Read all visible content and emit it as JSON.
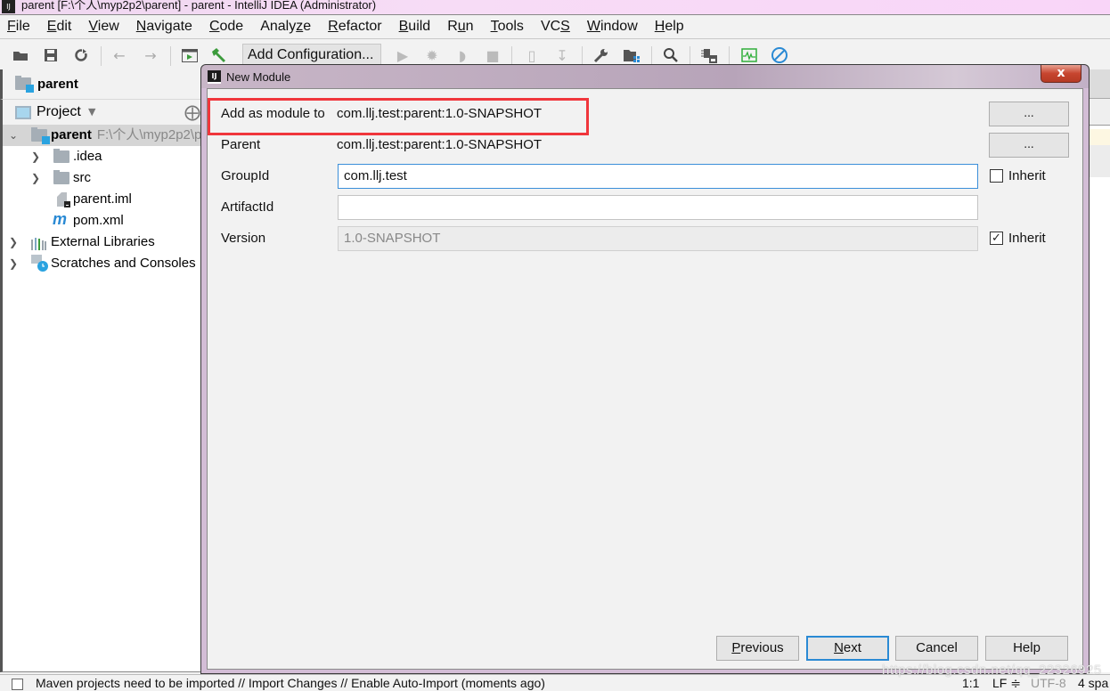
{
  "window": {
    "title": "parent [F:\\个人\\myp2p2\\parent] - parent - IntelliJ IDEA (Administrator)"
  },
  "menu": [
    {
      "label": "File",
      "mnemonic": "F",
      "rest": "ile"
    },
    {
      "label": "Edit",
      "mnemonic": "E",
      "rest": "dit"
    },
    {
      "label": "View",
      "mnemonic": "V",
      "rest": "iew"
    },
    {
      "label": "Navigate",
      "mnemonic": "N",
      "rest": "avigate"
    },
    {
      "label": "Code",
      "mnemonic": "C",
      "rest": "ode"
    },
    {
      "label": "Analyze",
      "pre": "Analy",
      "mnemonic": "z",
      "rest": "e"
    },
    {
      "label": "Refactor",
      "mnemonic": "R",
      "rest": "efactor"
    },
    {
      "label": "Build",
      "mnemonic": "B",
      "rest": "uild"
    },
    {
      "label": "Run",
      "pre": "R",
      "mnemonic": "u",
      "rest": "n"
    },
    {
      "label": "Tools",
      "mnemonic": "T",
      "rest": "ools"
    },
    {
      "label": "VCS",
      "pre": "VC",
      "mnemonic": "S",
      "rest": ""
    },
    {
      "label": "Window",
      "mnemonic": "W",
      "rest": "indow"
    },
    {
      "label": "Help",
      "mnemonic": "H",
      "rest": "elp"
    }
  ],
  "toolbar": {
    "add_configuration_label": "Add Configuration...",
    "icons": [
      "open-folder-icon",
      "save-icon",
      "sync-icon",
      "back-arrow-icon",
      "forward-arrow-icon",
      "run-window-icon",
      "build-hammer-icon",
      "run-icon",
      "debug-icon",
      "coverage-icon",
      "stop-icon",
      "vcs-update-icon",
      "vcs-commit-icon",
      "settings-wrench-icon",
      "project-structure-icon",
      "search-icon",
      "sdk-icon",
      "activity-monitor-icon",
      "power-save-icon"
    ]
  },
  "project_panel": {
    "header_name": "parent",
    "view_label": "Project",
    "tree": [
      {
        "label": "parent",
        "path": "F:\\个人\\myp2p2\\p",
        "expanded": true,
        "selected": true,
        "bold": true
      },
      {
        "label": ".idea",
        "expanded": false
      },
      {
        "label": "src",
        "expanded": false
      },
      {
        "label": "parent.iml"
      },
      {
        "label": "pom.xml"
      },
      {
        "label": "External Libraries",
        "expanded": false
      },
      {
        "label": "Scratches and Consoles",
        "expanded": false
      }
    ]
  },
  "dialog": {
    "title": "New Module",
    "close_label": "x",
    "fields": {
      "add_as_module_to": {
        "label": "Add as module to",
        "value": "com.llj.test:parent:1.0-SNAPSHOT",
        "button": "..."
      },
      "parent": {
        "label": "Parent",
        "value": "com.llj.test:parent:1.0-SNAPSHOT",
        "button": "..."
      },
      "group_id": {
        "label": "GroupId",
        "value": "com.llj.test",
        "inherit_label": "Inherit",
        "inherit_checked": false
      },
      "artifact_id": {
        "label": "ArtifactId",
        "value": ""
      },
      "version": {
        "label": "Version",
        "value": "1.0-SNAPSHOT",
        "inherit_label": "Inherit",
        "inherit_checked": true
      }
    },
    "buttons": {
      "previous": {
        "mnemonic": "P",
        "rest": "revious"
      },
      "next": {
        "mnemonic": "N",
        "rest": "ext"
      },
      "cancel": "Cancel",
      "help": "Help"
    },
    "highlight_color": "#f0363c"
  },
  "statusbar": {
    "message": "Maven projects need to be imported // Import Changes // Enable Auto-Import (moments ago)",
    "position": "1:1",
    "line_separator": "LF ≑",
    "encoding": "UTF-8",
    "indent": "4 spa"
  },
  "watermark": "https://blog.csdn.net/qq_22326925"
}
